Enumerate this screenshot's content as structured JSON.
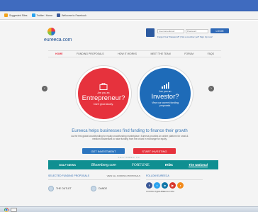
{
  "browser": {
    "bookmarks": [
      {
        "label": "Suggested Sites",
        "color": "#f1a21b"
      },
      {
        "label": "Twitter / Home",
        "color": "#2aa3ef"
      },
      {
        "label": "Welcome to Facebook",
        "color": "#3b5998"
      }
    ]
  },
  "site": {
    "brand": "eureeca.com",
    "login": {
      "email_placeholder": "Username/Email",
      "password_placeholder": "Password",
      "button": "LOGIN",
      "forgot": "Forgot Your Password? | Not a member yet? Sign Up now!"
    },
    "nav": [
      {
        "label": "HOME",
        "active": true
      },
      {
        "label": "FUNDING PROPOSALS",
        "active": false
      },
      {
        "label": "HOW IT WORKS",
        "active": false
      },
      {
        "label": "MEET THE TEAM",
        "active": false
      },
      {
        "label": "FORUM",
        "active": false
      },
      {
        "label": "FAQS",
        "active": false
      }
    ],
    "hero": {
      "left_arrow": "‹",
      "right_arrow": "›",
      "entrepreneur": {
        "question": "Are you an",
        "title": "Entrepreneur?",
        "sub": "Don't grow slowly."
      },
      "investor": {
        "question": "Are you an",
        "title": "Investor?",
        "sub": "View our current funding proposals."
      }
    },
    "tagline": "Eureeca helps businesses find funding to finance their growth",
    "description": "As the first global crowdfunding for equity crowdfunding marketplace, Eureeca provides an online platform for small & medium businesses to raise funding from the crowd in exchange for equity.",
    "cta": {
      "get_investment": "GET INVESTMENT",
      "start_investing": "START INVESTING"
    },
    "featured_label": "FEATURED IN",
    "press": [
      "GULF NEWS",
      "Bloomberg.com",
      "FORTUNE",
      "mbc",
      "The National"
    ],
    "selected": {
      "title": "SELECTED FUNDING PROPOSALS",
      "view_all": "VIEW ALL FUNDING PROPOSALS",
      "items": [
        {
          "name": "THE OUTLET"
        },
        {
          "name": "DANDE"
        }
      ]
    },
    "follow": {
      "title": "FOLLOW EUREECA",
      "contact": "CONTACT@EUREECA.COM",
      "socials": [
        {
          "name": "facebook-icon",
          "glyph": "f",
          "color": "#3b5998"
        },
        {
          "name": "twitter-icon",
          "glyph": "t",
          "color": "#2aa3ef"
        },
        {
          "name": "linkedin-icon",
          "glyph": "in",
          "color": "#0e76a8"
        },
        {
          "name": "youtube-icon",
          "glyph": "▶",
          "color": "#d7352b"
        },
        {
          "name": "rss-icon",
          "glyph": "r",
          "color": "#f28a1b"
        }
      ]
    }
  }
}
